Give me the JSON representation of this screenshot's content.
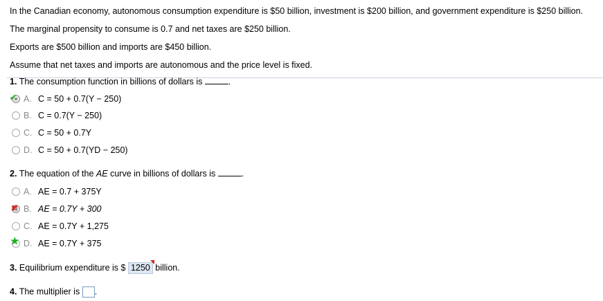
{
  "intro": {
    "p1": "In the Canadian economy, autonomous consumption expenditure is $50 billion, investment is $200 billion, and government expenditure is $250 billion.",
    "p2": "The marginal propensity to consume is 0.7 and net taxes are $250 billion.",
    "p3": "Exports are $500 billion and imports are $450 billion.",
    "p4": "Assume that net taxes and imports are autonomous and the price level is fixed."
  },
  "q1": {
    "number": "1.",
    "prompt": "The consumption function in billions of dollars is",
    "end": ".",
    "options": [
      {
        "letter": "A.",
        "text": "C = 50 + 0.7(Y − 250)",
        "mark": "✔"
      },
      {
        "letter": "B.",
        "text": "C = 0.7(Y − 250)"
      },
      {
        "letter": "C.",
        "text": "C = 50 + 0.7Y"
      },
      {
        "letter": "D.",
        "text": "C = 50 + 0.7(YD − 250)"
      }
    ]
  },
  "q2": {
    "number": "2.",
    "prompt_pre": "The equation of the",
    "prompt_em": "AE",
    "prompt_post": "curve in billions of dollars is",
    "end": ".",
    "options": [
      {
        "letter": "A.",
        "text": "AE = 0.7 + 375Y"
      },
      {
        "letter": "B.",
        "text": "AE = 0.7Y + 300",
        "mark": "✖"
      },
      {
        "letter": "C.",
        "text": "AE = 0.7Y + 1,275"
      },
      {
        "letter": "D.",
        "text": "AE = 0.7Y + 375",
        "mark": "★"
      }
    ]
  },
  "q3": {
    "number": "3.",
    "prompt": "Equilibrium expenditure is $",
    "answer": "1250",
    "suffix": "billion."
  },
  "q4": {
    "number": "4.",
    "prompt": "The multiplier is",
    "end": "."
  },
  "colors": {
    "correct": "#2fb52f",
    "incorrect": "#e01b1b",
    "divider": "#c9d3df",
    "answer_bg": "#dde6f2"
  }
}
